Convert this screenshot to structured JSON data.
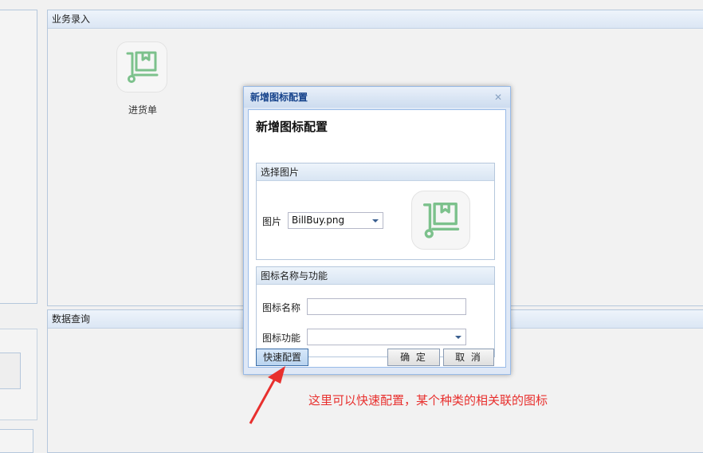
{
  "panels": {
    "business": {
      "title": "业务录入"
    },
    "query": {
      "title": "数据查询"
    }
  },
  "app_tiles": [
    {
      "label": "进货单",
      "icon": "cart-box-icon"
    }
  ],
  "dialog": {
    "window_title": "新增图标配置",
    "close_icon": "close-icon",
    "heading": "新增图标配置",
    "image_section": {
      "legend": "选择图片",
      "image_label": "图片",
      "image_value": "BillBuy.png"
    },
    "name_section": {
      "legend": "图标名称与功能",
      "name_label": "图标名称",
      "name_value": "",
      "function_label": "图标功能",
      "function_value": ""
    },
    "buttons": {
      "quick": "快速配置",
      "ok": "确 定",
      "cancel": "取 消"
    }
  },
  "annotation": {
    "text": "这里可以快速配置，某个种类的相关联的图标",
    "color": "#e8302e"
  },
  "colors": {
    "accent_blue": "#15428b",
    "icon_green": "#7cc18c"
  }
}
